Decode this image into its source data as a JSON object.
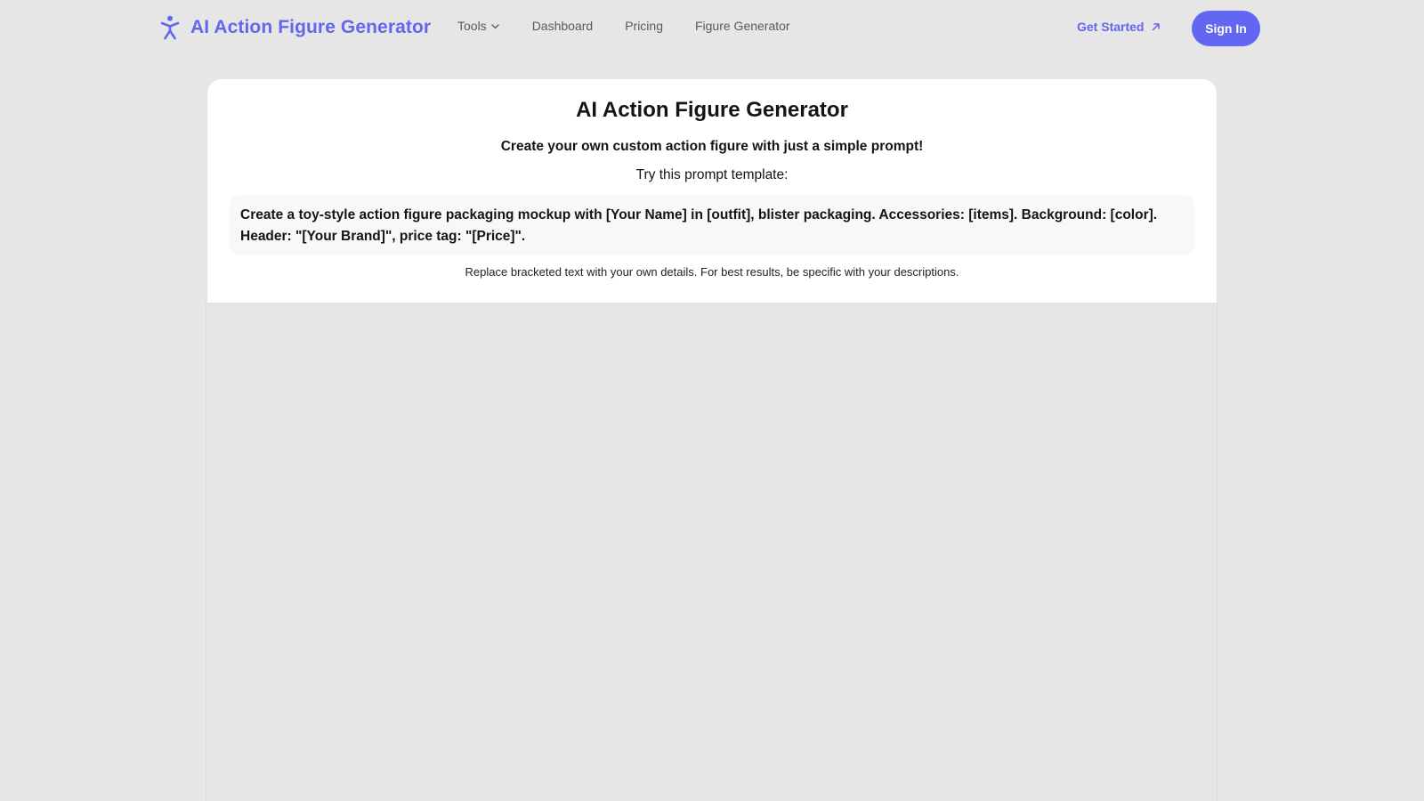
{
  "header": {
    "brand": {
      "name": "AI Action Figure Generator",
      "icon": "accessibility-figure-icon"
    },
    "nav": {
      "items": [
        {
          "label": "Tools",
          "has_dropdown": true
        },
        {
          "label": "Dashboard"
        },
        {
          "label": "Pricing"
        },
        {
          "label": "Figure Generator"
        }
      ]
    },
    "get_started_label": "Get Started",
    "sign_in_label": "Sign In"
  },
  "main": {
    "title": "AI Action Figure Generator",
    "subtitle": "Create your own custom action figure with just a simple prompt!",
    "template_label": "Try this prompt template:",
    "prompt_template": "Create a toy-style action figure packaging mockup with [Your Name] in [outfit], blister packaging. Accessories: [items]. Background: [color]. Header: \"[Your Brand]\", price tag: \"[Price]\".",
    "hint": "Replace bracketed text with your own details. For best results, be specific with your descriptions."
  },
  "colors": {
    "accent": "#6366f1",
    "page_background": "#e6e6e6",
    "card_background": "#ffffff",
    "prompt_background": "#f8f8f8",
    "nav_text": "#555b66"
  }
}
